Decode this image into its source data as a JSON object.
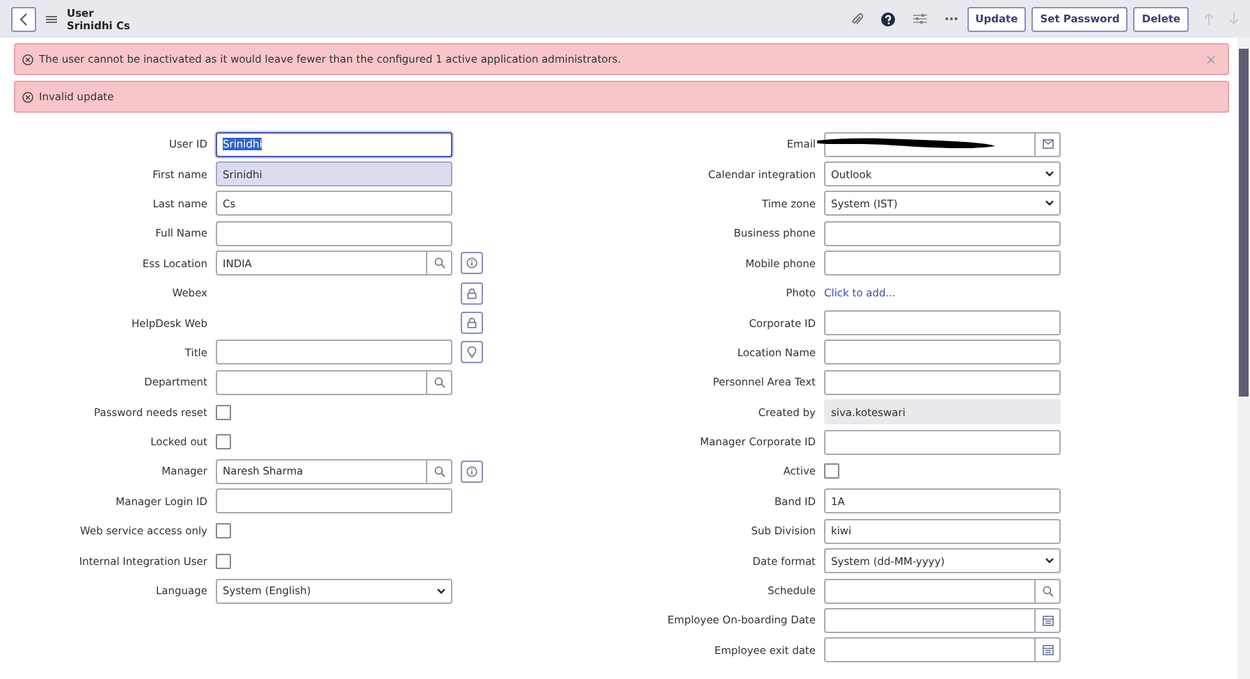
{
  "header": {
    "title": "User",
    "subtitle": "Srinidhi Cs",
    "buttons": [
      "Update",
      "Set Password",
      "Delete"
    ],
    "nav_disabled": true
  },
  "alerts": [
    {
      "text": "The user cannot be inactivated as it would leave fewer than the configured 1 active application administrators.",
      "closable": true
    },
    {
      "text": "Invalid update",
      "closable": false
    }
  ],
  "left_fields": [
    {
      "label": "User ID",
      "kind": "text",
      "value": "Srinidhi",
      "focused": true
    },
    {
      "label": "First name",
      "kind": "text",
      "value": "Srinidhi",
      "autofilled": true
    },
    {
      "label": "Last name",
      "kind": "text",
      "value": "Cs"
    },
    {
      "label": "Full Name",
      "kind": "text"
    },
    {
      "label": "Ess Location",
      "kind": "lookup",
      "value": "INDIA",
      "side": {
        "kind": "info"
      }
    },
    {
      "label": "Webex",
      "kind": "none",
      "side": {
        "kind": "lock"
      }
    },
    {
      "label": "HelpDesk Web",
      "kind": "none",
      "side": {
        "kind": "lock"
      }
    },
    {
      "label": "Title",
      "kind": "text",
      "side": {
        "kind": "bulb"
      }
    },
    {
      "label": "Department",
      "kind": "lookup"
    },
    {
      "label": "Password needs reset",
      "kind": "checkbox",
      "checked": false
    },
    {
      "label": "Locked out",
      "kind": "checkbox",
      "checked": false
    },
    {
      "label": "Manager",
      "kind": "lookup",
      "value": "Naresh Sharma",
      "side": {
        "kind": "info"
      }
    },
    {
      "label": "Manager Login ID",
      "kind": "text"
    },
    {
      "label": "Web service access only",
      "kind": "checkbox",
      "checked": false
    },
    {
      "label": "Internal Integration User",
      "kind": "checkbox",
      "checked": false
    },
    {
      "label": "Language",
      "kind": "select",
      "value": "System (English)"
    }
  ],
  "right_fields": [
    {
      "label": "Email",
      "kind": "email",
      "redacted": true
    },
    {
      "label": "Calendar integration",
      "kind": "select",
      "value": "Outlook"
    },
    {
      "label": "Time zone",
      "kind": "select",
      "value": "System (IST)"
    },
    {
      "label": "Business phone",
      "kind": "text"
    },
    {
      "label": "Mobile phone",
      "kind": "text"
    },
    {
      "label": "Photo",
      "kind": "link",
      "value": "Click to add..."
    },
    {
      "label": "Corporate ID",
      "kind": "text"
    },
    {
      "label": "Location Name",
      "kind": "text"
    },
    {
      "label": "Personnel Area Text",
      "kind": "text"
    },
    {
      "label": "Created by",
      "kind": "readonly",
      "value": "siva.koteswari"
    },
    {
      "label": "Manager Corporate ID",
      "kind": "text"
    },
    {
      "label": "Active",
      "kind": "checkbox",
      "checked": false
    },
    {
      "label": "Band ID",
      "kind": "text",
      "value": "1A"
    },
    {
      "label": "Sub Division",
      "kind": "text",
      "value": "kiwi"
    },
    {
      "label": "Date format",
      "kind": "select",
      "value": "System (dd-MM-yyyy)"
    },
    {
      "label": "Schedule",
      "kind": "lookup"
    },
    {
      "label": "Employee On-boarding Date",
      "kind": "date"
    },
    {
      "label": "Employee exit date",
      "kind": "date"
    }
  ]
}
